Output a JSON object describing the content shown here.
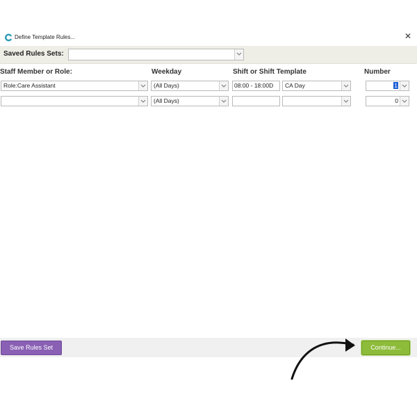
{
  "window": {
    "title": "Define Template Rules...",
    "app_icon": "c-logo-icon",
    "close_glyph": "✕",
    "brand_color": "#2a9bb5"
  },
  "saved_rules": {
    "label": "Saved Rules Sets:",
    "selected": ""
  },
  "columns": {
    "staff": "Staff Member or Role:",
    "weekday": "Weekday",
    "shift": "Shift or Shift Template",
    "number": "Number"
  },
  "rows": [
    {
      "staff": "Role:Care Assistant",
      "weekday": "(All Days)",
      "shift_time": "08:00 - 18:00D",
      "shift_template": "CA Day",
      "number": "1"
    },
    {
      "staff": "",
      "weekday": "(All Days)",
      "shift_time": "",
      "shift_template": "",
      "number": "0"
    }
  ],
  "buttons": {
    "save": "Save Rules Set",
    "continue": "Continue..."
  },
  "colors": {
    "save_button": "#8960b4",
    "continue_button": "#8dbb3a",
    "band": "#efeee6"
  },
  "annotation": {
    "icon": "curved-arrow-icon"
  }
}
